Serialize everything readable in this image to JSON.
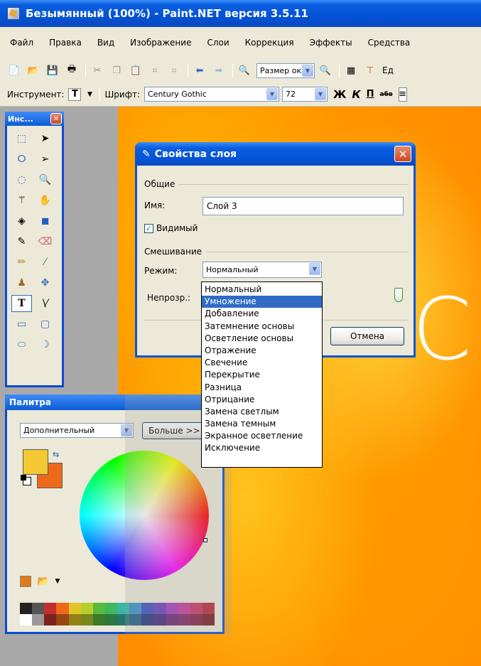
{
  "window": {
    "title": "Безымянный (100%) - Paint.NET версия 3.5.11"
  },
  "menu": [
    "Файл",
    "Правка",
    "Вид",
    "Изображение",
    "Слои",
    "Коррекция",
    "Эффекты",
    "Средства"
  ],
  "toolbar": {
    "zoom_combo": "Размер окн",
    "units_label": "Ед"
  },
  "text_toolbar": {
    "tool_label": "Инструмент:",
    "font_label": "Шрифт:",
    "font_value": "Century Gothic",
    "size_value": "72",
    "bold": "Ж",
    "italic": "К",
    "underline": "П",
    "strike": "абв"
  },
  "tools_window": {
    "title": "Инс..."
  },
  "palette": {
    "title": "Палитра",
    "palette_combo": "Дополнительный",
    "more_button": "Больше >>",
    "primary_color": "#f3c832",
    "secondary_color": "#ee6a1a",
    "swatches": [
      "#222222",
      "#555555",
      "#c0312e",
      "#ee6a1a",
      "#e0c526",
      "#b6cf2b",
      "#58b93a",
      "#3fb861",
      "#38b6a8",
      "#3792c9",
      "#3b4fc1",
      "#6a3ebd",
      "#a33fb8",
      "#c33d97",
      "#c43665",
      "#b62a3c",
      "#ffffff",
      "#999999",
      "#7c2120",
      "#9a4512",
      "#93811a",
      "#78881c",
      "#3b7a27",
      "#2a7a41",
      "#25776e",
      "#245f84",
      "#27347e",
      "#452a7b",
      "#6b2a78",
      "#802864",
      "#812443",
      "#781d28"
    ]
  },
  "dialog": {
    "title": "Свойства слоя",
    "group_general": "Общие",
    "name_label": "Имя:",
    "name_value": "Слой 3",
    "visible_label": "Видимый",
    "group_blend": "Смешивание",
    "mode_label": "Режим:",
    "mode_value": "Нормальный",
    "opacity_label": "Непрозр.:",
    "cancel_button": "Отмена"
  },
  "blend_modes": {
    "selected_index": 1,
    "options": [
      "Нормальный",
      "Умножение",
      "Добавление",
      "Затемнение основы",
      "Осветление основы",
      "Отражение",
      "Свечение",
      "Перекрытие",
      "Разница",
      "Отрицание",
      "Замена светлым",
      "Замена темным",
      "Экранное осветление",
      "Исключение"
    ]
  },
  "canvas": {
    "text": "CN"
  }
}
